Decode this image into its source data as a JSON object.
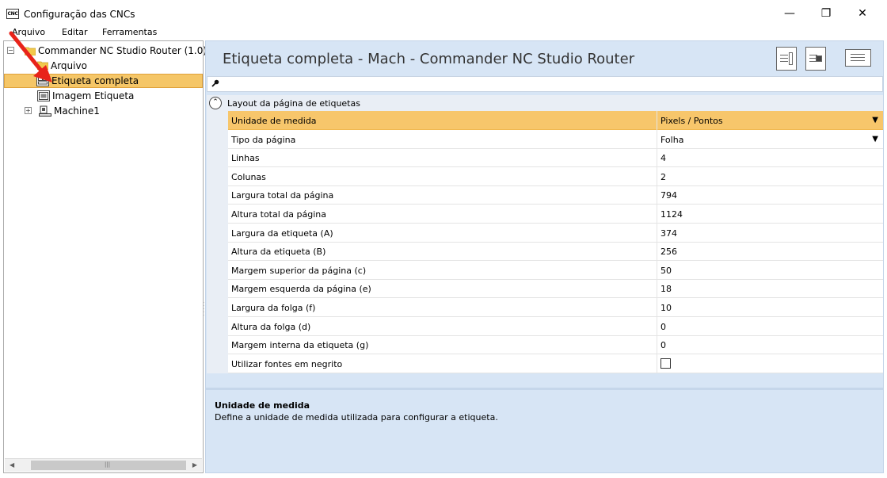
{
  "window": {
    "title": "Configuração das CNCs",
    "app_icon_text": "CNC",
    "minimize": "—",
    "maximize": "❐",
    "close": "✕"
  },
  "menu": [
    "Arquivo",
    "Editar",
    "Ferramentas"
  ],
  "tree": {
    "root": "Commander NC Studio Router (1.0)",
    "children": [
      "Arquivo",
      "Etiqueta completa",
      "Imagem Etiqueta"
    ],
    "machine": "Machine1",
    "selected": "Etiqueta completa"
  },
  "header": {
    "title": "Etiqueta completa - Mach - Commander NC Studio Router"
  },
  "grid": {
    "category": "Layout da página de etiquetas",
    "rows": [
      {
        "name": "Unidade de medida",
        "value": "Pixels / Pontos",
        "dropdown": true,
        "selected": true
      },
      {
        "name": "Tipo da página",
        "value": "Folha",
        "dropdown": true
      },
      {
        "name": "Linhas",
        "value": "4"
      },
      {
        "name": "Colunas",
        "value": "2"
      },
      {
        "name": "Largura total da página",
        "value": "794"
      },
      {
        "name": "Altura total da página",
        "value": "1124"
      },
      {
        "name": "Largura da etiqueta (A)",
        "value": "374"
      },
      {
        "name": "Altura da etiqueta (B)",
        "value": "256"
      },
      {
        "name": "Margem superior da página (c)",
        "value": "50"
      },
      {
        "name": "Margem esquerda da página (e)",
        "value": "18"
      },
      {
        "name": "Largura da folga (f)",
        "value": "10"
      },
      {
        "name": "Altura da folga (d)",
        "value": "0"
      },
      {
        "name": "Margem interna da etiqueta (g)",
        "value": "0"
      },
      {
        "name": "Utilizar fontes em negrito",
        "value": "",
        "checkbox": true
      }
    ]
  },
  "description": {
    "title": "Unidade de medida",
    "text": "Define a unidade de medida utilizada para configurar a etiqueta."
  },
  "colors": {
    "selection": "#f7c66b",
    "panel_bg": "#d7e5f5",
    "arrow": "#e8231a"
  }
}
